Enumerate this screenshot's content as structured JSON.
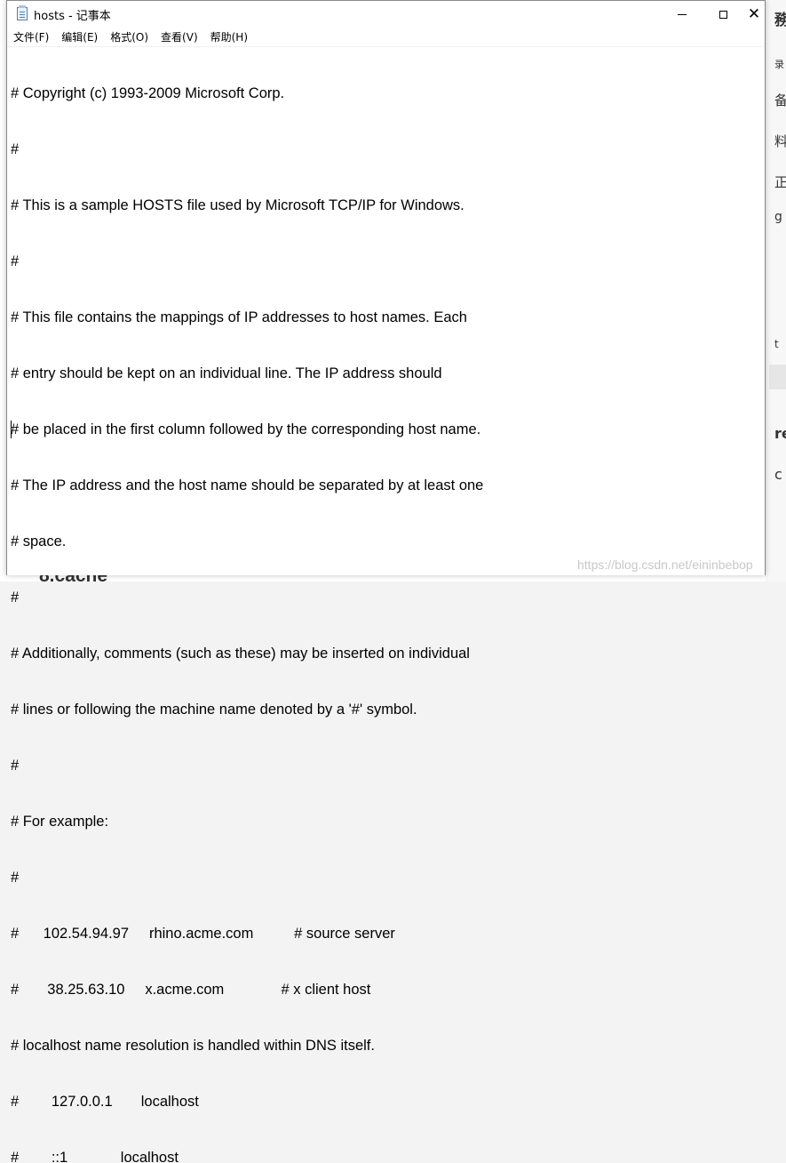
{
  "window": {
    "title": "hosts - 记事本",
    "controls": {
      "minimize": "minimize",
      "maximize": "maximize",
      "close": "✕"
    }
  },
  "menu": [
    {
      "label": "文件(F)"
    },
    {
      "label": "编辑(E)"
    },
    {
      "label": "格式(O)"
    },
    {
      "label": "查看(V)"
    },
    {
      "label": "帮助(H)"
    }
  ],
  "editor": {
    "lines": [
      "# Copyright (c) 1993-2009 Microsoft Corp.",
      "#",
      "# This is a sample HOSTS file used by Microsoft TCP/IP for Windows.",
      "#",
      "# This file contains the mappings of IP addresses to host names. Each",
      "# entry should be kept on an individual line. The IP address should",
      "# be placed in the first column followed by the corresponding host name.",
      "# The IP address and the host name should be separated by at least one",
      "# space.",
      "#",
      "# Additionally, comments (such as these) may be inserted on individual",
      "# lines or following the machine name denoted by a '#' symbol.",
      "#",
      "# For example:",
      "#",
      "#      102.54.94.97     rhino.acme.com          # source server",
      "#       38.25.63.10     x.acme.com              # x client host",
      "# localhost name resolution is handled within DNS itself.",
      "#\t127.0.0.1       localhost",
      "#\t::1             localhost"
    ]
  },
  "background": {
    "heading": "8.cache",
    "watermark": "https://blog.csdn.net/eininbebop",
    "right_fragments": [
      "務",
      "录",
      "备",
      "料",
      "正",
      "g",
      "t",
      "re",
      "c"
    ]
  }
}
